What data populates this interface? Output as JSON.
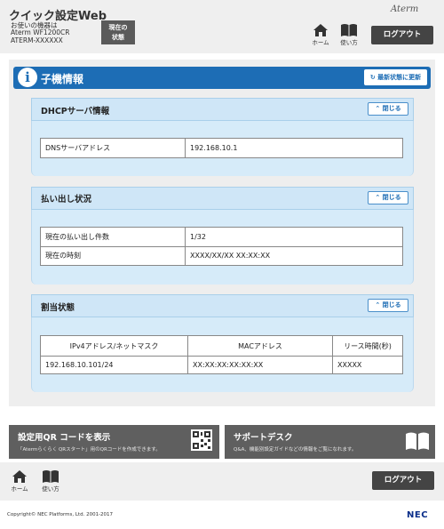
{
  "header": {
    "title": "クイック設定Web",
    "device_line1": "お使いの機器は",
    "device_line2": "Aterm WF1200CR",
    "device_line3": "ATERM-XXXXXX",
    "status_button_line1": "現在の",
    "status_button_line2": "状態",
    "brand": "Aterm",
    "home_label": "ホーム",
    "help_label": "使い方",
    "logout_label": "ログアウト"
  },
  "page": {
    "title": "子機情報",
    "refresh_label": "最新状態に更新"
  },
  "sections": {
    "dhcp": {
      "title": "DHCPサーバ情報",
      "close_label": "閉じる",
      "rows": [
        {
          "label": "DNSサーバアドレス",
          "value": "192.168.10.1"
        }
      ]
    },
    "lease_status": {
      "title": "払い出し状況",
      "close_label": "閉じる",
      "rows": [
        {
          "label": "現在の払い出し件数",
          "value": "1/32"
        },
        {
          "label": "現在の時刻",
          "value": "XXXX/XX/XX XX:XX:XX"
        }
      ]
    },
    "assignment": {
      "title": "割当状態",
      "close_label": "閉じる",
      "headers": [
        "IPv4アドレス/ネットマスク",
        "MACアドレス",
        "リース時間(秒)"
      ],
      "rows": [
        [
          "192.168.10.101/24",
          "XX:XX:XX:XX:XX:XX",
          "XXXXX"
        ]
      ]
    }
  },
  "bottom": {
    "qr_title": "設定用QR コードを表示",
    "qr_sub": "「Atermらくらく QRスタート」用のQRコードを作成できます。",
    "support_title": "サポートデスク",
    "support_sub": "Q&A、機能別設定ガイドなどの情報をご覧になれます。"
  },
  "footer": {
    "home_label": "ホーム",
    "help_label": "使い方",
    "logout_label": "ログアウト",
    "copyright": "Copyright© NEC Platforms, Ltd. 2001-2017",
    "logo": "NEC"
  },
  "colors": {
    "accent": "#1d6db5",
    "section_head": "#cfe6f7",
    "section_body": "#d6ebf9",
    "dark_button": "#444444"
  }
}
